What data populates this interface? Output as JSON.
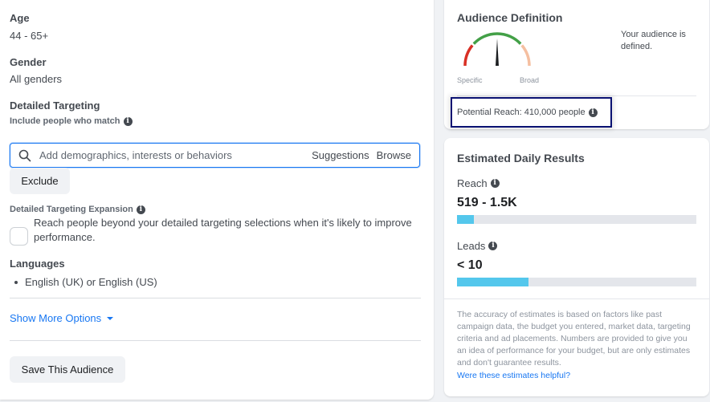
{
  "left_panel": {
    "age": {
      "label": "Age",
      "value": "44 - 65+"
    },
    "gender": {
      "label": "Gender",
      "value": "All genders"
    },
    "detailed_targeting": {
      "label": "Detailed Targeting",
      "sublabel": "Include people who match",
      "search_placeholder": "Add demographics, interests or behaviors",
      "search_value": "",
      "suggestions_label": "Suggestions",
      "browse_label": "Browse",
      "exclude_label": "Exclude"
    },
    "expansion": {
      "label": "Detailed Targeting Expansion",
      "checkbox_checked": false,
      "checkbox_text": "Reach people beyond your detailed targeting selections when it's likely to improve performance."
    },
    "languages": {
      "label": "Languages",
      "items": [
        "English (UK) or English (US)"
      ]
    },
    "show_more_label": "Show More Options",
    "save_audience_label": "Save This Audience"
  },
  "audience_definition": {
    "title": "Audience Definition",
    "gauge": {
      "min_label": "Specific",
      "max_label": "Broad",
      "needle_position": 0.5,
      "colors": {
        "specific": "#d93025",
        "defined": "#43a047",
        "broad": "#f5bfa0"
      }
    },
    "status_text": "Your audience is defined.",
    "potential_reach": "Potential Reach: 410,000 people"
  },
  "estimated_results": {
    "title": "Estimated Daily Results",
    "metrics": [
      {
        "label": "Reach",
        "value": "519 - 1.5K",
        "fill_fraction": 0.07
      },
      {
        "label": "Leads",
        "value": "< 10",
        "fill_fraction": 0.3
      }
    ],
    "note": "The accuracy of estimates is based on factors like past campaign data, the budget you entered, market data, targeting criteria and ad placements. Numbers are provided to give you an idea of performance for your budget, but are only estimates and don't guarantee results.",
    "feedback_link": "Were these estimates helpful?"
  },
  "colors": {
    "accent": "#1877f2",
    "bar_fill": "#54c7ec",
    "highlight_border": "#0a1172"
  }
}
